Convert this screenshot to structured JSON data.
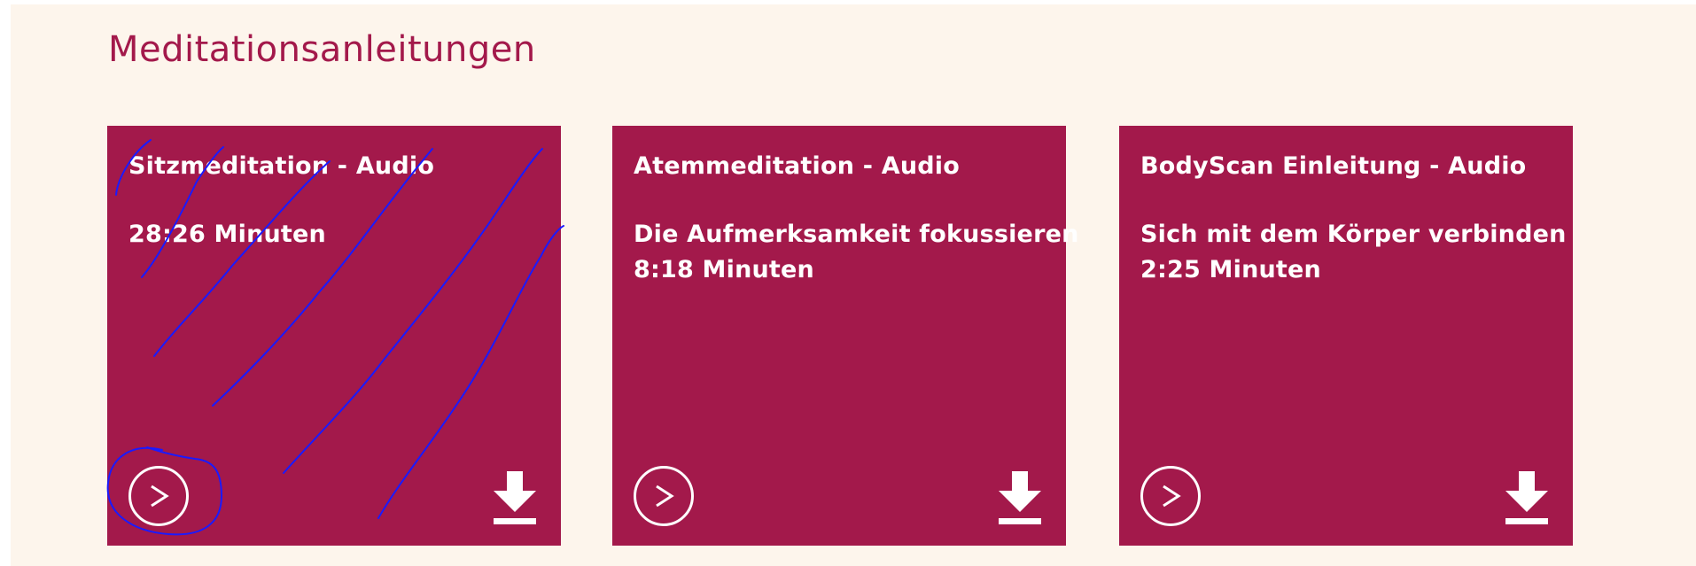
{
  "section": {
    "title": "Meditationsanleitungen"
  },
  "cards": [
    {
      "title": "Sitzmeditation - Audio",
      "description": "",
      "duration": "28:26 Minuten",
      "play_icon": "play-circle-icon",
      "download_icon": "download-icon"
    },
    {
      "title": "Atemmeditation - Audio",
      "description": "Die Aufmerksamkeit fokussieren",
      "duration": "8:18 Minuten",
      "play_icon": "play-circle-icon",
      "download_icon": "download-icon"
    },
    {
      "title": "BodyScan Einleitung - Audio",
      "description": "Sich mit dem Körper verbinden",
      "duration": "2:25 Minuten",
      "play_icon": "play-circle-icon",
      "download_icon": "download-icon"
    }
  ],
  "colors": {
    "background": "#fdf5ec",
    "card": "#a3194b",
    "title": "#a3194b",
    "text": "#ffffff",
    "annotation_stroke": "#1a1aff"
  }
}
